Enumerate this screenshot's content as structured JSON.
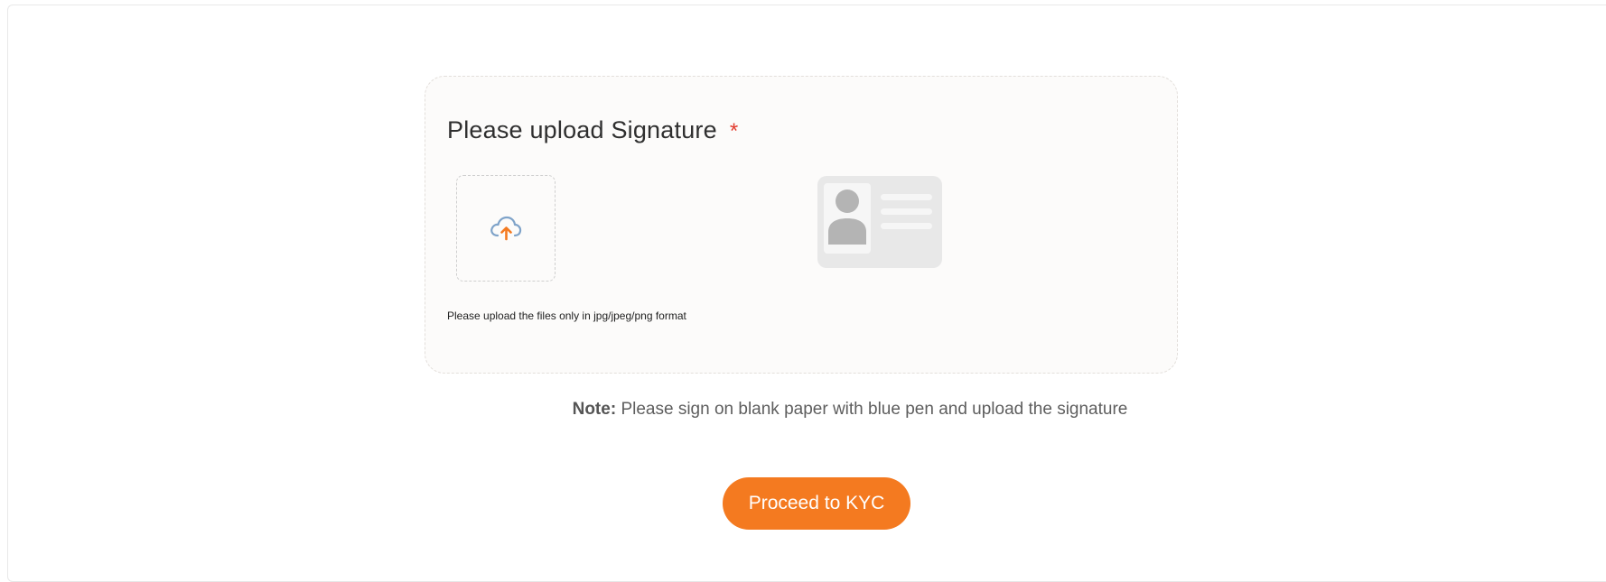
{
  "upload": {
    "title": "Please upload Signature",
    "required_marker": "*",
    "format_hint": "Please upload the files only in jpg/jpeg/png format",
    "dropzone_icon": "cloud-upload-icon",
    "placeholder_icon": "id-card-icon"
  },
  "note": {
    "label": "Note:",
    "text": "Please sign on blank paper with blue pen and upload the signature"
  },
  "actions": {
    "proceed_label": "Proceed to KYC"
  },
  "colors": {
    "accent": "#f47a20",
    "required": "#e23b2e",
    "icon_blue": "#7fa3c9",
    "placeholder_gray": "#e8e8e8"
  }
}
